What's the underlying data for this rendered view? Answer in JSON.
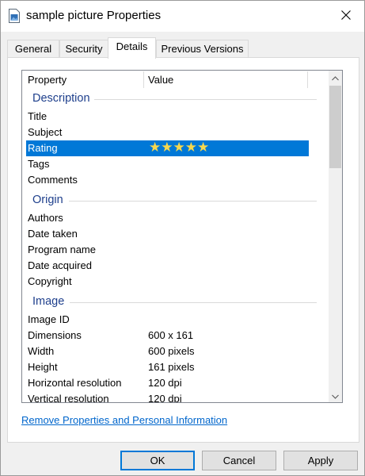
{
  "window": {
    "title": "sample picture Properties"
  },
  "tabs": [
    {
      "label": "General"
    },
    {
      "label": "Security"
    },
    {
      "label": "Details"
    },
    {
      "label": "Previous Versions"
    }
  ],
  "active_tab": "Details",
  "columns": {
    "property": "Property",
    "value": "Value"
  },
  "groups": {
    "description": {
      "label": "Description",
      "rows": [
        {
          "name": "Title",
          "value": ""
        },
        {
          "name": "Subject",
          "value": ""
        },
        {
          "name": "Rating",
          "value": "",
          "rating_stars": 5,
          "rating_max": 5,
          "selected": true
        },
        {
          "name": "Tags",
          "value": ""
        },
        {
          "name": "Comments",
          "value": ""
        }
      ]
    },
    "origin": {
      "label": "Origin",
      "rows": [
        {
          "name": "Authors",
          "value": ""
        },
        {
          "name": "Date taken",
          "value": ""
        },
        {
          "name": "Program name",
          "value": ""
        },
        {
          "name": "Date acquired",
          "value": ""
        },
        {
          "name": "Copyright",
          "value": ""
        }
      ]
    },
    "image": {
      "label": "Image",
      "rows": [
        {
          "name": "Image ID",
          "value": ""
        },
        {
          "name": "Dimensions",
          "value": "600 x 161"
        },
        {
          "name": "Width",
          "value": "600 pixels"
        },
        {
          "name": "Height",
          "value": "161 pixels"
        },
        {
          "name": "Horizontal resolution",
          "value": "120 dpi"
        },
        {
          "name": "Vertical resolution",
          "value": "120 dpi"
        }
      ]
    }
  },
  "links": {
    "remove_properties": "Remove Properties and Personal Information"
  },
  "buttons": {
    "ok": "OK",
    "cancel": "Cancel",
    "apply": "Apply"
  },
  "colors": {
    "selection": "#0078d7",
    "group_label": "#1e3f8c",
    "link": "#0066cc",
    "star": "#f7d84e"
  },
  "icons": {
    "window_icon": "picture-file-icon",
    "close": "close-icon",
    "scroll_up": "chevron-up-icon",
    "scroll_down": "chevron-down-icon",
    "rating": "star-icon"
  }
}
